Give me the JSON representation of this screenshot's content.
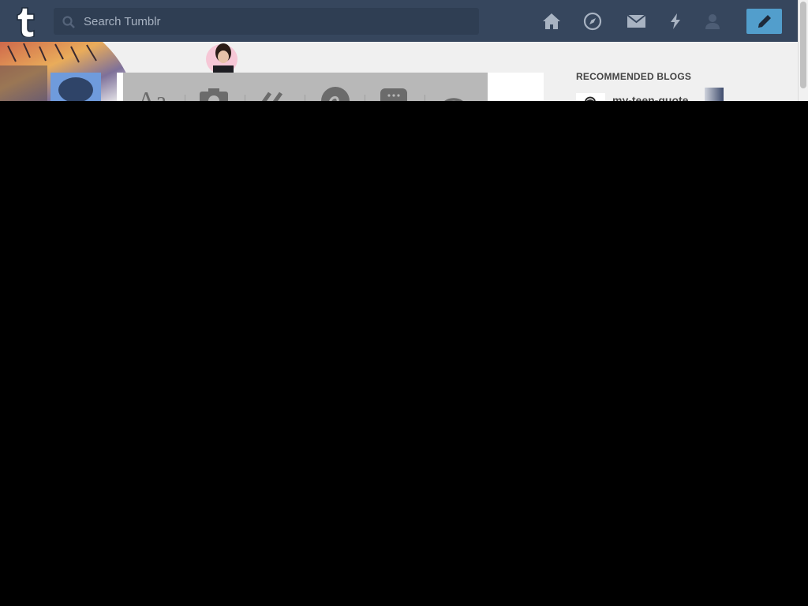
{
  "header": {
    "logo_icon": "tumblr-logo-icon",
    "search": {
      "placeholder": "Search Tumblr",
      "value": "",
      "icon": "search-icon"
    },
    "nav": [
      {
        "name": "home",
        "icon": "home-icon"
      },
      {
        "name": "explore",
        "icon": "compass-icon"
      },
      {
        "name": "inbox",
        "icon": "mail-icon"
      },
      {
        "name": "activity",
        "icon": "lightning-icon"
      },
      {
        "name": "account",
        "icon": "person-icon"
      }
    ],
    "compose_icon": "pencil-icon",
    "colors": {
      "bar": "#36465d",
      "search": "#2f3e53",
      "compose": "#529ecc",
      "icon": "#a8b3c2"
    }
  },
  "post_types": [
    {
      "name": "text",
      "icon": "text-aa-icon"
    },
    {
      "name": "photo",
      "icon": "camera-icon"
    },
    {
      "name": "quote",
      "icon": "quote-icon"
    },
    {
      "name": "link",
      "icon": "link-icon"
    },
    {
      "name": "chat",
      "icon": "chat-icon"
    },
    {
      "name": "audio",
      "icon": "headphones-icon"
    }
  ],
  "sidebar": {
    "recommended_title": "RECOMMENDED BLOGS",
    "blogs": [
      {
        "name": "my-teen-quote"
      }
    ]
  }
}
